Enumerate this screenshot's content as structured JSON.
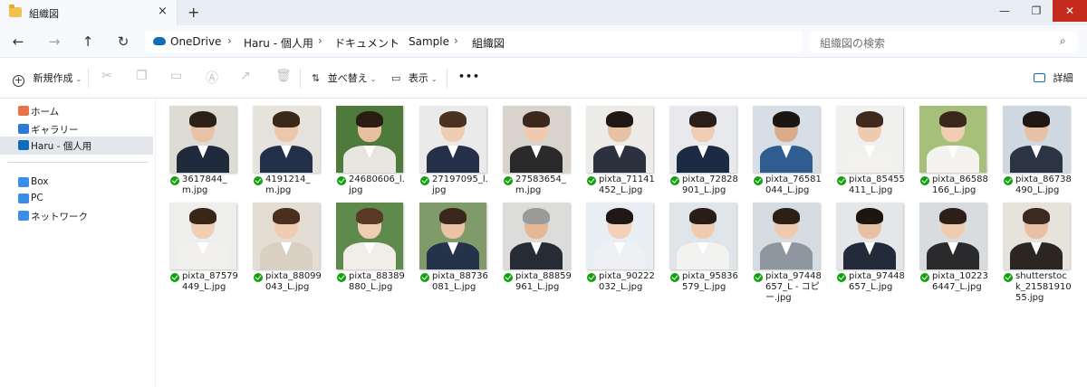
{
  "tab": {
    "title": "組織図",
    "close": "×",
    "new_tab": "+"
  },
  "window_controls": {
    "minimize": "—",
    "maximize": "❐",
    "close": "✕"
  },
  "nav": {
    "back": "←",
    "forward": "→",
    "up": "↑",
    "refresh": "↻"
  },
  "breadcrumb": [
    {
      "label": "OneDrive"
    },
    {
      "label": "Haru - 個人用"
    },
    {
      "label": "ドキュメント"
    },
    {
      "label": "Sample"
    },
    {
      "label": "組織図"
    }
  ],
  "breadcrumb_separator": "›",
  "search": {
    "placeholder": "組織図の検索",
    "icon": "⌕"
  },
  "commands": {
    "new": "新規作成",
    "sort": "並べ替え",
    "view": "表示",
    "more": "•••",
    "details": "詳細"
  },
  "sidebar": {
    "items": [
      {
        "label": "ホーム",
        "icon": "home-icon",
        "color": "#e8734a"
      },
      {
        "label": "ギャラリー",
        "icon": "gallery-icon",
        "color": "#2f7ad8"
      },
      {
        "label": "Haru - 個人用",
        "icon": "cloud-icon",
        "color": "#0f6cbd"
      },
      {
        "label": "Box",
        "icon": "box-icon",
        "color": "#3a8ee6"
      },
      {
        "label": "PC",
        "icon": "pc-icon",
        "color": "#3a8ee6"
      },
      {
        "label": "ネットワーク",
        "icon": "network-icon",
        "color": "#3a8ee6"
      }
    ],
    "selected_index": 2
  },
  "files": [
    {
      "name": "3617844_m.jpg",
      "bg": "#dedad4",
      "skin": "#e9c2a6",
      "hair": "#2b2118",
      "cloth": "#1f2a3d"
    },
    {
      "name": "4191214_m.jpg",
      "bg": "#e6e2dc",
      "skin": "#ecc7aa",
      "hair": "#3a2818",
      "cloth": "#22304a"
    },
    {
      "name": "24680606_l.jpg",
      "bg": "#4e7a3b",
      "skin": "#e8bf9f",
      "hair": "#2a1d14",
      "cloth": "#e9e6e1"
    },
    {
      "name": "27197095_l.jpg",
      "bg": "#eaeaea",
      "skin": "#efcbb1",
      "hair": "#4a3122",
      "cloth": "#243047"
    },
    {
      "name": "27583654_m.jpg",
      "bg": "#d8d3cc",
      "skin": "#efcab0",
      "hair": "#3b271b",
      "cloth": "#2a2a2a"
    },
    {
      "name": "pixta_71141452_L.jpg",
      "bg": "#ecebe8",
      "skin": "#e8c0a2",
      "hair": "#1f1814",
      "cloth": "#2c3140"
    },
    {
      "name": "pixta_72828901_L.jpg",
      "bg": "#e7e9ec",
      "skin": "#efccb3",
      "hair": "#2a1e18",
      "cloth": "#1d2a44"
    },
    {
      "name": "pixta_76581044_L.jpg",
      "bg": "#d7dee6",
      "skin": "#d9ab88",
      "hair": "#1c1612",
      "cloth": "#2f5d8f"
    },
    {
      "name": "pixta_85455411_L.jpg",
      "bg": "#f0f0ee",
      "skin": "#efcab0",
      "hair": "#3f2a1d",
      "cloth": "#f3f1ee"
    },
    {
      "name": "pixta_86588166_L.jpg",
      "bg": "#a6c07a",
      "skin": "#f1cdb4",
      "hair": "#3a271b",
      "cloth": "#f4f2ef"
    },
    {
      "name": "pixta_86738490_L.jpg",
      "bg": "#cfd8e0",
      "skin": "#e7c1a3",
      "hair": "#1e1814",
      "cloth": "#2a3444"
    },
    {
      "name": "pixta_87579449_L.jpg",
      "bg": "#eeeeec",
      "skin": "#f0cdb3",
      "hair": "#3a2519",
      "cloth": "#f2f0ec"
    },
    {
      "name": "pixta_88099043_L.jpg",
      "bg": "#e4ddd3",
      "skin": "#efcbb0",
      "hair": "#4a2f1f",
      "cloth": "#d9cfc3"
    },
    {
      "name": "pixta_88389880_L.jpg",
      "bg": "#5e8a4c",
      "skin": "#f0cdb2",
      "hair": "#5a3a24",
      "cloth": "#f1ede7"
    },
    {
      "name": "pixta_88736081_L.jpg",
      "bg": "#7f9b6a",
      "skin": "#eac3a6",
      "hair": "#3a271c",
      "cloth": "#26324a"
    },
    {
      "name": "pixta_88859961_L.jpg",
      "bg": "#dcdcda",
      "skin": "#e2b895",
      "hair": "#9a9a98",
      "cloth": "#262b36"
    },
    {
      "name": "pixta_90222032_L.jpg",
      "bg": "#e8eef2",
      "skin": "#f2d0b8",
      "hair": "#1f1814",
      "cloth": "#eef0f3"
    },
    {
      "name": "pixta_95836579_L.jpg",
      "bg": "#dfe5e9",
      "skin": "#efcbb1",
      "hair": "#2a1d16",
      "cloth": "#f2f2f0"
    },
    {
      "name": "pixta_97448657_L - コピー.jpg",
      "bg": "#d6dde2",
      "skin": "#efcab0",
      "hair": "#2c1f16",
      "cloth": "#8e979f"
    },
    {
      "name": "pixta_97448657_L.jpg",
      "bg": "#e4e6e8",
      "skin": "#e8c1a2",
      "hair": "#1c1612",
      "cloth": "#232b3a"
    },
    {
      "name": "pixta_102236447_L.jpg",
      "bg": "#d9dcdf",
      "skin": "#efcbb0",
      "hair": "#2d1f17",
      "cloth": "#2a2a2c"
    },
    {
      "name": "shutterstock_2158191055.jpg",
      "bg": "#e7e2dc",
      "skin": "#e7c1a3",
      "hair": "#3b2a1f",
      "cloth": "#2b2622"
    }
  ]
}
